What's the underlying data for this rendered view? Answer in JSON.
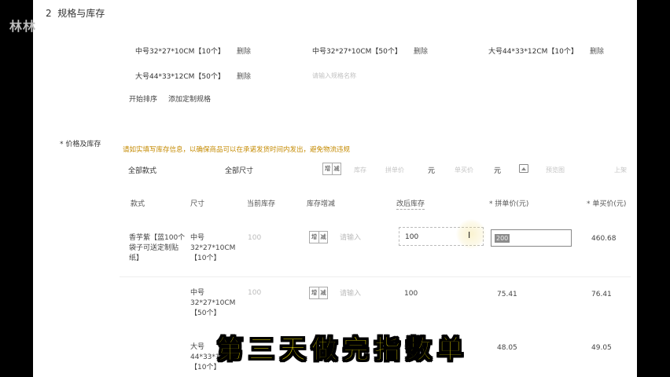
{
  "watermark": "林林",
  "section": {
    "number": "2",
    "title": "规格与库存"
  },
  "sku_options": [
    {
      "label": "中号32*27*10CM【10个】",
      "delete": "删除"
    },
    {
      "label": "中号32*27*10CM【50个】",
      "delete": "删除"
    },
    {
      "label": "大号44*33*12CM【10个】",
      "delete": "删除"
    },
    {
      "label": "大号44*33*12CM【50个】",
      "delete": "删除"
    }
  ],
  "sku_new_placeholder": "请输入规格名称",
  "links": {
    "start_sort": "开始排序",
    "add_custom": "添加定制规格"
  },
  "price_stock": {
    "title": "* 价格及库存",
    "notice": "请如实填写库存信息，以确保商品可以在承诺发货时间内发出，避免物流违规"
  },
  "filters": {
    "style": "全部款式",
    "size": "全部尺寸",
    "add": "增",
    "reduce": "减",
    "stock_placeholder": "库存",
    "group_price_placeholder": "拼单价",
    "yuan1": "元",
    "single_price_placeholder": "单买价",
    "yuan2": "元",
    "preview": "预览图",
    "more": "上架"
  },
  "table": {
    "headers": {
      "style": "款式",
      "size": "尺寸",
      "current_stock": "当前库存",
      "stock_change": "库存增减",
      "after_stock": "改后库存",
      "group_price": "* 拼单价(元)",
      "single_price": "* 单买价(元)"
    },
    "rows": [
      {
        "style": "香芋紫【蓝100个袋子可送定制贴纸】",
        "size": "中号32*27*10CM【10个】",
        "current_stock": "100",
        "add": "增",
        "reduce": "减",
        "placeholder": "请输入",
        "after_stock": "100",
        "group_price": "200",
        "single_price": "460.68"
      },
      {
        "style": "",
        "size": "中号32*27*10CM【50个】",
        "current_stock": "100",
        "add": "增",
        "reduce": "减",
        "placeholder": "请输入",
        "after_stock": "100",
        "group_price": "75.41",
        "single_price": "76.41"
      },
      {
        "style": "",
        "size": "大号44*33*12CM【10个】",
        "current_stock": "",
        "add": "",
        "reduce": "",
        "placeholder": "",
        "after_stock": "",
        "group_price": "48.05",
        "single_price": "49.05"
      }
    ]
  },
  "subtitle": "第三天做完指数单"
}
